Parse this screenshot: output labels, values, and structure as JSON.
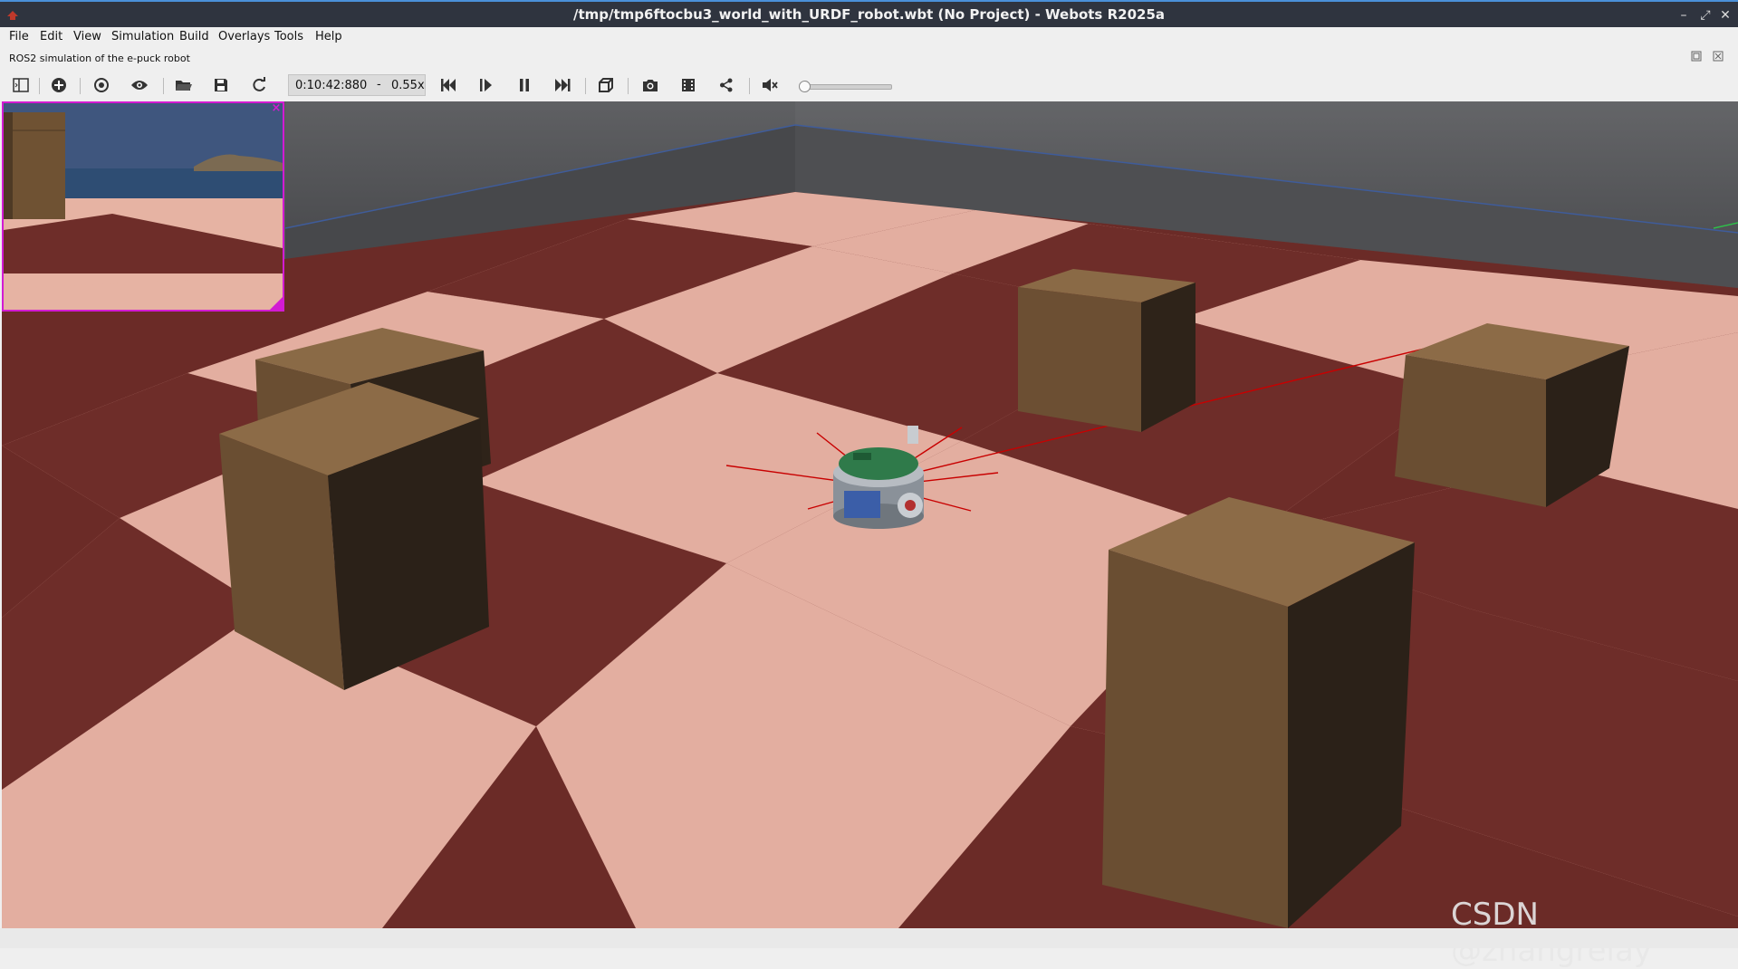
{
  "window": {
    "title": "/tmp/tmp6ftocbu3_world_with_URDF_robot.wbt (No Project) - Webots R2025a",
    "controls": {
      "minimize": "–",
      "maximize": "⤢",
      "close": "✕"
    }
  },
  "menubar": {
    "items": [
      {
        "label": "File",
        "icon": ""
      },
      {
        "label": "Edit"
      },
      {
        "label": "View"
      },
      {
        "label": "Simulation"
      },
      {
        "label": "Build"
      },
      {
        "label": "Overlays"
      },
      {
        "label": "Tools"
      },
      {
        "label": "Help"
      }
    ]
  },
  "description": "ROS2 simulation of the e-puck robot",
  "toolbar": {
    "simulation_time": "0:10:42:880",
    "separator": "-",
    "speed": "0.55x",
    "icons": [
      "scene-tree-icon",
      "add-node-icon",
      "follow-object-icon",
      "eye-icon",
      "open-world-icon",
      "save-world-icon",
      "reload-world-icon",
      "step-back-icon",
      "step-icon",
      "pause-icon",
      "fast-forward-icon",
      "render-mode-icon",
      "screenshot-icon",
      "record-movie-icon",
      "share-icon",
      "mute-icon"
    ],
    "volume_level": 0.0
  },
  "overlay": {
    "camera_close": "×"
  },
  "watermark": "CSDN @zhangrelay",
  "colors": {
    "accent": "#4a90d9",
    "titlebar": "#2f343f",
    "camera_border": "#d21bd2",
    "floor_light": "#e6b3a3",
    "floor_dark": "#6a2a27",
    "crate": "#7a5a3a",
    "sensor_ray": "#cc0000"
  }
}
